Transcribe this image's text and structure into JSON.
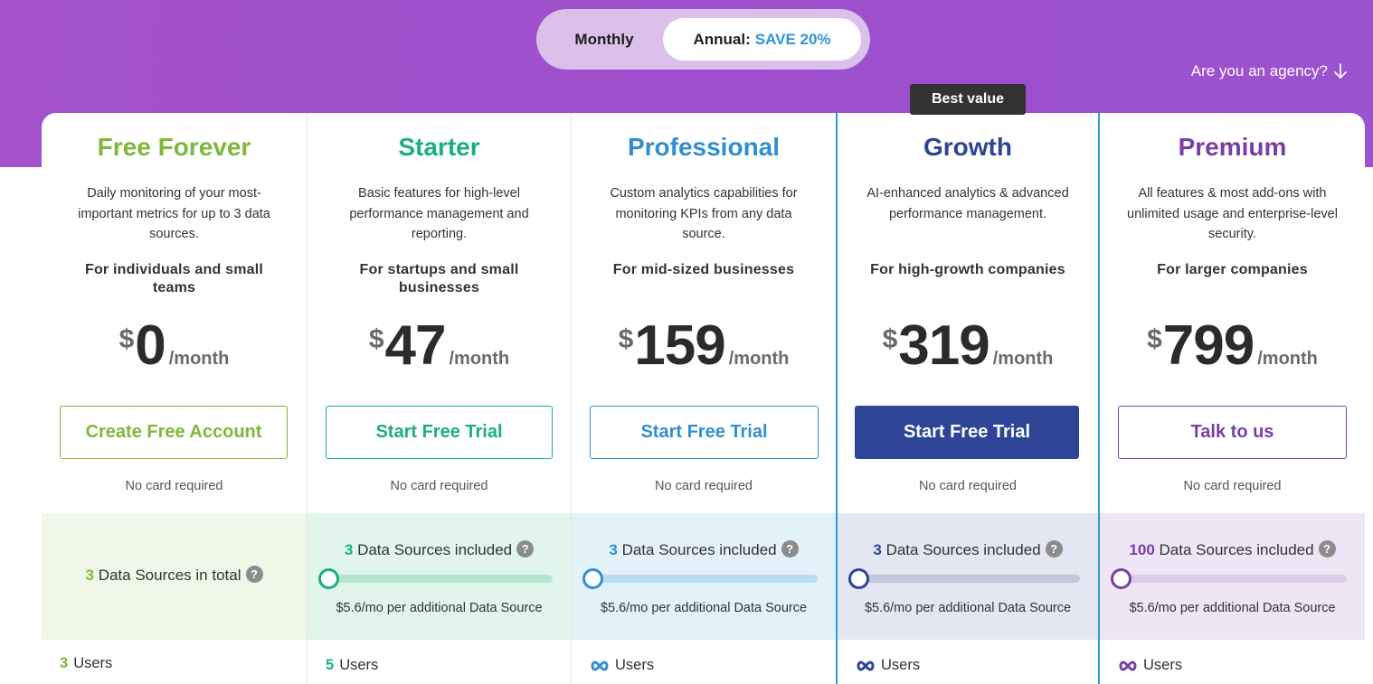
{
  "billing_toggle": {
    "monthly_label": "Monthly",
    "annual_label": "Annual:",
    "annual_badge": "SAVE 20%"
  },
  "agency_link": {
    "label": "Are you an agency?",
    "icon": "arrow-down-icon"
  },
  "featured_badge": "Best value",
  "plans": [
    {
      "name": "Free Forever",
      "color": "#7cb83a",
      "description": "Daily monitoring of your most-important metrics for up to 3 data sources.",
      "audience": "For individuals and small teams",
      "currency": "$",
      "price": "0",
      "period": "/month",
      "cta": "Create Free Account",
      "note": "No card required",
      "data_sources_count": "3",
      "data_sources_text": "Data Sources in total",
      "users_count": "3",
      "users_label": "Users"
    },
    {
      "name": "Starter",
      "color": "#1ab07a",
      "description": "Basic features for high-level performance management and reporting.",
      "audience": "For startups and small businesses",
      "currency": "$",
      "price": "47",
      "period": "/month",
      "cta": "Start Free Trial",
      "note": "No card required",
      "data_sources_count": "3",
      "data_sources_text": "Data Sources included",
      "additional": "$5.6/mo per additional Data Source",
      "slider_value": 0,
      "users_count": "5",
      "users_label": "Users"
    },
    {
      "name": "Professional",
      "color": "#2f8fd0",
      "description": "Custom analytics capabilities for monitoring KPIs from any data source.",
      "audience": "For mid-sized businesses",
      "currency": "$",
      "price": "159",
      "period": "/month",
      "cta": "Start Free Trial",
      "note": "No card required",
      "data_sources_count": "3",
      "data_sources_text": "Data Sources included",
      "additional": "$5.6/mo per additional Data Source",
      "slider_value": 0,
      "users_count": "∞",
      "users_label": "Users"
    },
    {
      "name": "Growth",
      "color": "#2d4594",
      "description": "AI-enhanced analytics & advanced performance management.",
      "audience": "For high-growth companies",
      "currency": "$",
      "price": "319",
      "period": "/month",
      "cta": "Start Free Trial",
      "note": "No card required",
      "data_sources_count": "3",
      "data_sources_text": "Data Sources included",
      "additional": "$5.6/mo per additional Data Source",
      "slider_value": 0,
      "users_count": "∞",
      "users_label": "Users"
    },
    {
      "name": "Premium",
      "color": "#7a3ea5",
      "description": "All features & most add-ons with unlimited usage and enterprise-level security.",
      "audience": "For larger companies",
      "currency": "$",
      "price": "799",
      "period": "/month",
      "cta": "Talk to us",
      "note": "No card required",
      "data_sources_count": "100",
      "data_sources_text": "Data Sources included",
      "additional": "$5.6/mo per additional Data Source",
      "slider_value": 0,
      "users_count": "∞",
      "users_label": "Users"
    }
  ]
}
